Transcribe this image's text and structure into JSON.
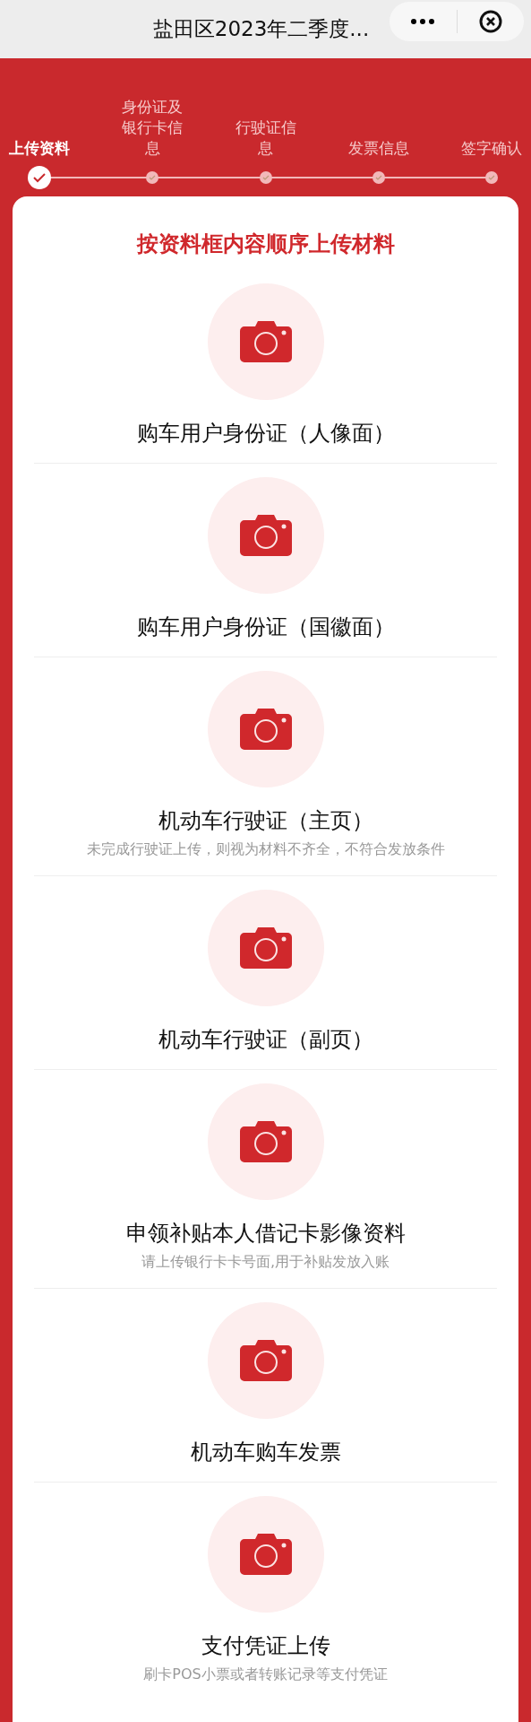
{
  "title_bar": {
    "title": "盐田区2023年二季度..."
  },
  "steps": [
    {
      "label": "上传资料",
      "selected": true
    },
    {
      "label": "身份证及银行卡信息",
      "selected": false
    },
    {
      "label": "行驶证信息",
      "selected": false
    },
    {
      "label": "发票信息",
      "selected": false
    },
    {
      "label": "签字确认",
      "selected": false
    }
  ],
  "heading": "按资料框内容顺序上传材料",
  "uploads": [
    {
      "title": "购车用户身份证（人像面）"
    },
    {
      "title": "购车用户身份证（国徽面）"
    },
    {
      "title": "机动车行驶证（主页）",
      "note": "未完成行驶证上传，则视为材料不齐全，不符合发放条件"
    },
    {
      "title": "机动车行驶证（副页）"
    },
    {
      "title": "申领补贴本人借记卡影像资料",
      "note": "请上传银行卡卡号面,用于补贴发放入账"
    },
    {
      "title": "机动车购车发票"
    },
    {
      "title": "支付凭证上传",
      "note": "刷卡POS小票或者转账记录等支付凭证"
    }
  ]
}
